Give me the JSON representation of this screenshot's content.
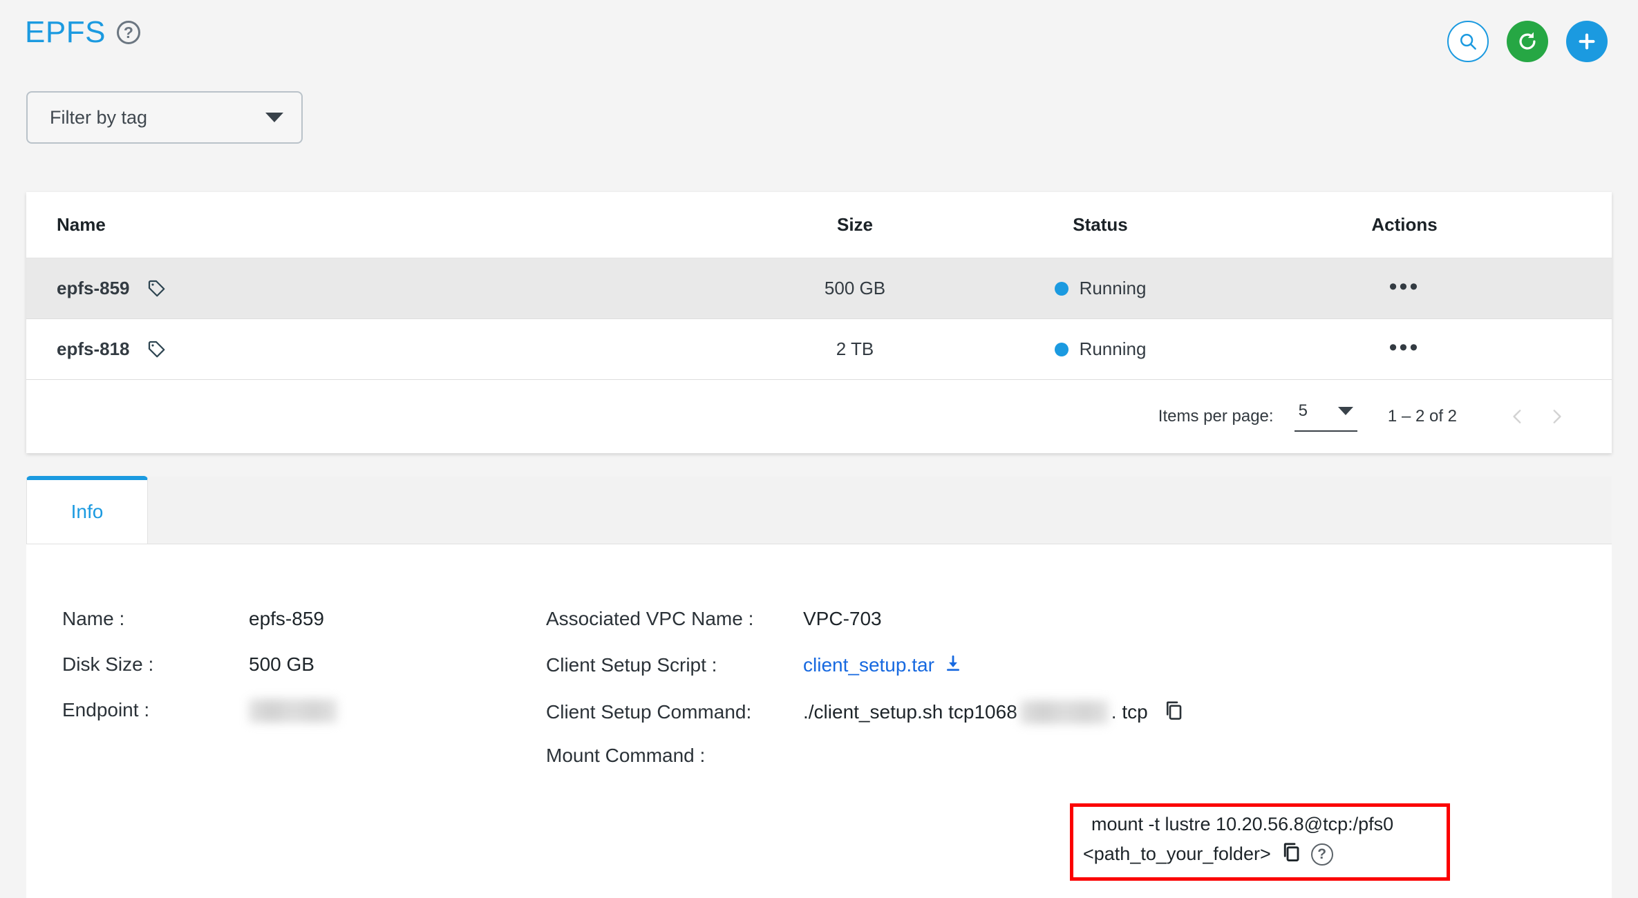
{
  "header": {
    "title": "EPFS",
    "help_icon": "help-circle-icon",
    "actions": [
      {
        "name": "search-button",
        "icon": "search-icon",
        "style": "outline",
        "color": "#1b9ae0"
      },
      {
        "name": "refresh-button",
        "icon": "refresh-icon",
        "style": "filled",
        "color": "#26a744"
      },
      {
        "name": "add-button",
        "icon": "plus-icon",
        "style": "filled",
        "color": "#1b9ae0"
      }
    ]
  },
  "filter": {
    "label": "Filter by tag",
    "icon": "chevron-down-icon"
  },
  "table": {
    "columns": [
      "Name",
      "Size",
      "Status",
      "Actions"
    ],
    "rows": [
      {
        "name": "epfs-859",
        "size": "500 GB",
        "status": "Running",
        "status_color": "#1b9ae0",
        "tag_icon": "tag-icon",
        "actions_icon": "more-horizontal-icon",
        "selected": true
      },
      {
        "name": "epfs-818",
        "size": "2 TB",
        "status": "Running",
        "status_color": "#1b9ae0",
        "tag_icon": "tag-icon",
        "actions_icon": "more-horizontal-icon",
        "selected": false
      }
    ],
    "paginator": {
      "items_per_page_label": "Items per page:",
      "items_per_page_value": "5",
      "range_label": "1 – 2 of 2",
      "prev_icon": "chevron-left-icon",
      "next_icon": "chevron-right-icon"
    }
  },
  "tabs": [
    {
      "label": "Info",
      "active": true
    }
  ],
  "info": {
    "left": [
      {
        "label": "Name :",
        "value": "epfs-859",
        "redacted": false
      },
      {
        "label": "Disk Size :",
        "value": "500 GB",
        "redacted": false
      },
      {
        "label": "Endpoint :",
        "value": "",
        "redacted": true
      }
    ],
    "right": {
      "vpc": {
        "label": "Associated VPC Name :",
        "value": "VPC-703"
      },
      "script": {
        "label": "Client Setup Script :",
        "value": "client_setup.tar",
        "download_icon": "download-icon"
      },
      "setup_command": {
        "label": "Client Setup Command:",
        "prefix": "./client_setup.sh tcp1068",
        "suffix": ". tcp",
        "redacted": true,
        "copy_icon": "copy-icon"
      },
      "mount_command": {
        "label": "Mount Command :",
        "line1": "mount -t lustre 10.20.56.8@tcp:/pfs0",
        "line2": "<path_to_your_folder>",
        "copy_icon": "copy-icon",
        "help_icon": "help-circle-icon",
        "highlight_color": "#fb0000"
      }
    }
  }
}
